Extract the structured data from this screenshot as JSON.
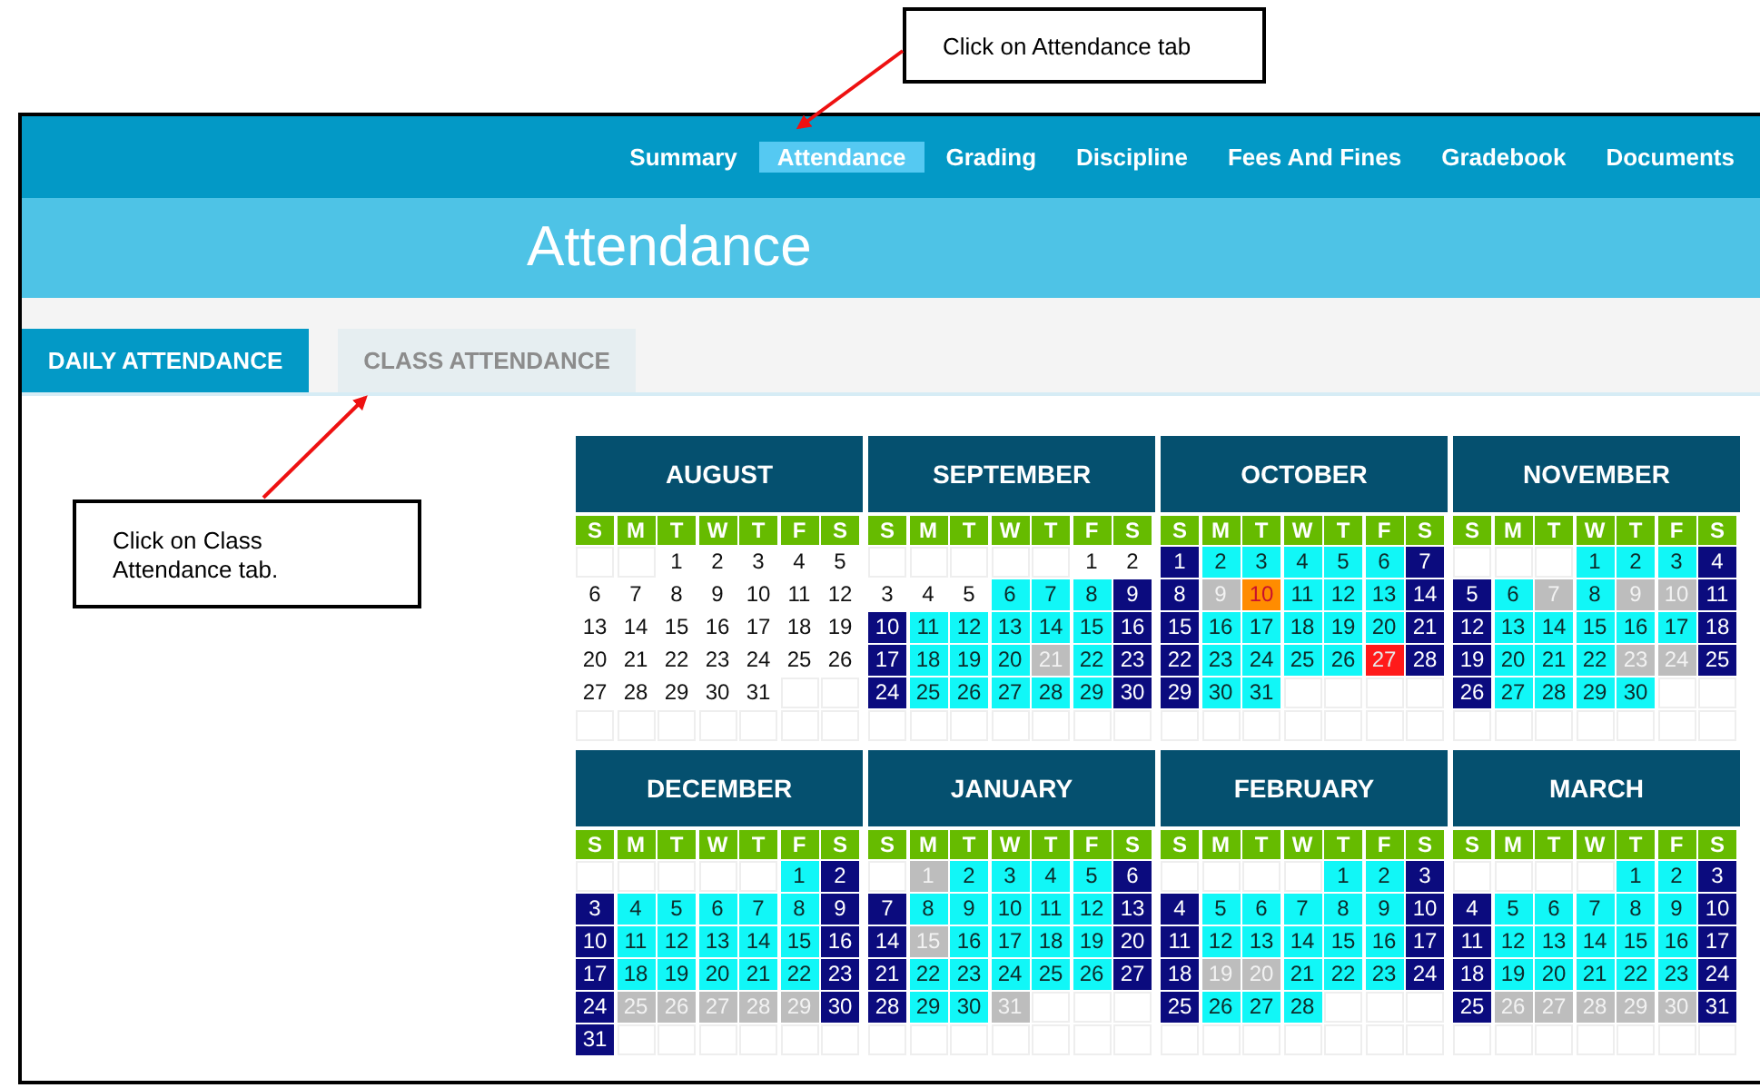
{
  "callouts": [
    {
      "text": "Click on Attendance tab"
    },
    {
      "text": "Click on Class Attendance tab."
    }
  ],
  "nav": {
    "tabs": [
      {
        "label": "Summary",
        "selected": false
      },
      {
        "label": "Attendance",
        "selected": true
      },
      {
        "label": "Grading",
        "selected": false
      },
      {
        "label": "Discipline",
        "selected": false
      },
      {
        "label": "Fees And Fines",
        "selected": false
      },
      {
        "label": "Gradebook",
        "selected": false
      },
      {
        "label": "Documents",
        "selected": false
      }
    ]
  },
  "page_title": "Attendance",
  "sub_tabs": [
    {
      "label": "DAILY ATTENDANCE",
      "selected": true
    },
    {
      "label": "CLASS ATTENDANCE",
      "selected": false
    }
  ],
  "months": [
    {
      "name": "AUGUST",
      "weekdays": [
        "S",
        "M",
        "T",
        "W",
        "T",
        "F",
        "S"
      ],
      "weeks": [
        [
          {
            "kind": "blank"
          },
          {
            "kind": "blank"
          },
          {
            "day": "1",
            "kind": "plain"
          },
          {
            "day": "2",
            "kind": "plain"
          },
          {
            "day": "3",
            "kind": "plain"
          },
          {
            "day": "4",
            "kind": "plain"
          },
          {
            "day": "5",
            "kind": "plain"
          }
        ],
        [
          {
            "day": "6",
            "kind": "plain"
          },
          {
            "day": "7",
            "kind": "plain"
          },
          {
            "day": "8",
            "kind": "plain"
          },
          {
            "day": "9",
            "kind": "plain"
          },
          {
            "day": "10",
            "kind": "plain"
          },
          {
            "day": "11",
            "kind": "plain"
          },
          {
            "day": "12",
            "kind": "plain"
          }
        ],
        [
          {
            "day": "13",
            "kind": "plain"
          },
          {
            "day": "14",
            "kind": "plain"
          },
          {
            "day": "15",
            "kind": "plain"
          },
          {
            "day": "16",
            "kind": "plain"
          },
          {
            "day": "17",
            "kind": "plain"
          },
          {
            "day": "18",
            "kind": "plain"
          },
          {
            "day": "19",
            "kind": "plain"
          }
        ],
        [
          {
            "day": "20",
            "kind": "plain"
          },
          {
            "day": "21",
            "kind": "plain"
          },
          {
            "day": "22",
            "kind": "plain"
          },
          {
            "day": "23",
            "kind": "plain"
          },
          {
            "day": "24",
            "kind": "plain"
          },
          {
            "day": "25",
            "kind": "plain"
          },
          {
            "day": "26",
            "kind": "plain"
          }
        ],
        [
          {
            "day": "27",
            "kind": "plain"
          },
          {
            "day": "28",
            "kind": "plain"
          },
          {
            "day": "29",
            "kind": "plain"
          },
          {
            "day": "30",
            "kind": "plain"
          },
          {
            "day": "31",
            "kind": "plain"
          },
          {
            "kind": "blank"
          },
          {
            "kind": "blank"
          }
        ],
        [
          {
            "kind": "blank"
          },
          {
            "kind": "blank"
          },
          {
            "kind": "blank"
          },
          {
            "kind": "blank"
          },
          {
            "kind": "blank"
          },
          {
            "kind": "blank"
          },
          {
            "kind": "blank"
          }
        ]
      ]
    },
    {
      "name": "SEPTEMBER",
      "weekdays": [
        "S",
        "M",
        "T",
        "W",
        "T",
        "F",
        "S"
      ],
      "weeks": [
        [
          {
            "kind": "blank"
          },
          {
            "kind": "blank"
          },
          {
            "kind": "blank"
          },
          {
            "kind": "blank"
          },
          {
            "kind": "blank"
          },
          {
            "day": "1",
            "kind": "plain"
          },
          {
            "day": "2",
            "kind": "plain"
          }
        ],
        [
          {
            "day": "3",
            "kind": "plain"
          },
          {
            "day": "4",
            "kind": "plain"
          },
          {
            "day": "5",
            "kind": "plain"
          },
          {
            "day": "6",
            "kind": "school"
          },
          {
            "day": "7",
            "kind": "school"
          },
          {
            "day": "8",
            "kind": "school"
          },
          {
            "day": "9",
            "kind": "weekend"
          }
        ],
        [
          {
            "day": "10",
            "kind": "weekend"
          },
          {
            "day": "11",
            "kind": "school"
          },
          {
            "day": "12",
            "kind": "school"
          },
          {
            "day": "13",
            "kind": "school"
          },
          {
            "day": "14",
            "kind": "school"
          },
          {
            "day": "15",
            "kind": "school"
          },
          {
            "day": "16",
            "kind": "weekend"
          }
        ],
        [
          {
            "day": "17",
            "kind": "weekend"
          },
          {
            "day": "18",
            "kind": "school"
          },
          {
            "day": "19",
            "kind": "school"
          },
          {
            "day": "20",
            "kind": "school"
          },
          {
            "day": "21",
            "kind": "holiday"
          },
          {
            "day": "22",
            "kind": "school"
          },
          {
            "day": "23",
            "kind": "weekend"
          }
        ],
        [
          {
            "day": "24",
            "kind": "weekend"
          },
          {
            "day": "25",
            "kind": "school"
          },
          {
            "day": "26",
            "kind": "school"
          },
          {
            "day": "27",
            "kind": "school"
          },
          {
            "day": "28",
            "kind": "school"
          },
          {
            "day": "29",
            "kind": "school"
          },
          {
            "day": "30",
            "kind": "weekend"
          }
        ],
        [
          {
            "kind": "blank"
          },
          {
            "kind": "blank"
          },
          {
            "kind": "blank"
          },
          {
            "kind": "blank"
          },
          {
            "kind": "blank"
          },
          {
            "kind": "blank"
          },
          {
            "kind": "blank"
          }
        ]
      ]
    },
    {
      "name": "OCTOBER",
      "weekdays": [
        "S",
        "M",
        "T",
        "W",
        "T",
        "F",
        "S"
      ],
      "weeks": [
        [
          {
            "day": "1",
            "kind": "weekend"
          },
          {
            "day": "2",
            "kind": "school"
          },
          {
            "day": "3",
            "kind": "school"
          },
          {
            "day": "4",
            "kind": "school"
          },
          {
            "day": "5",
            "kind": "school"
          },
          {
            "day": "6",
            "kind": "school"
          },
          {
            "day": "7",
            "kind": "weekend"
          }
        ],
        [
          {
            "day": "8",
            "kind": "weekend"
          },
          {
            "day": "9",
            "kind": "holiday"
          },
          {
            "day": "10",
            "kind": "late"
          },
          {
            "day": "11",
            "kind": "school"
          },
          {
            "day": "12",
            "kind": "school"
          },
          {
            "day": "13",
            "kind": "school"
          },
          {
            "day": "14",
            "kind": "weekend"
          }
        ],
        [
          {
            "day": "15",
            "kind": "weekend"
          },
          {
            "day": "16",
            "kind": "school"
          },
          {
            "day": "17",
            "kind": "school"
          },
          {
            "day": "18",
            "kind": "school"
          },
          {
            "day": "19",
            "kind": "school"
          },
          {
            "day": "20",
            "kind": "school"
          },
          {
            "day": "21",
            "kind": "weekend"
          }
        ],
        [
          {
            "day": "22",
            "kind": "weekend"
          },
          {
            "day": "23",
            "kind": "school"
          },
          {
            "day": "24",
            "kind": "school"
          },
          {
            "day": "25",
            "kind": "school"
          },
          {
            "day": "26",
            "kind": "school"
          },
          {
            "day": "27",
            "kind": "absent"
          },
          {
            "day": "28",
            "kind": "weekend"
          }
        ],
        [
          {
            "day": "29",
            "kind": "weekend"
          },
          {
            "day": "30",
            "kind": "school"
          },
          {
            "day": "31",
            "kind": "school"
          },
          {
            "kind": "blank"
          },
          {
            "kind": "blank"
          },
          {
            "kind": "blank"
          },
          {
            "kind": "blank"
          }
        ],
        [
          {
            "kind": "blank"
          },
          {
            "kind": "blank"
          },
          {
            "kind": "blank"
          },
          {
            "kind": "blank"
          },
          {
            "kind": "blank"
          },
          {
            "kind": "blank"
          },
          {
            "kind": "blank"
          }
        ]
      ]
    },
    {
      "name": "NOVEMBER",
      "weekdays": [
        "S",
        "M",
        "T",
        "W",
        "T",
        "F",
        "S"
      ],
      "weeks": [
        [
          {
            "kind": "blank"
          },
          {
            "kind": "blank"
          },
          {
            "kind": "blank"
          },
          {
            "day": "1",
            "kind": "school"
          },
          {
            "day": "2",
            "kind": "school"
          },
          {
            "day": "3",
            "kind": "school"
          },
          {
            "day": "4",
            "kind": "weekend"
          }
        ],
        [
          {
            "day": "5",
            "kind": "weekend"
          },
          {
            "day": "6",
            "kind": "school"
          },
          {
            "day": "7",
            "kind": "holiday"
          },
          {
            "day": "8",
            "kind": "school"
          },
          {
            "day": "9",
            "kind": "holiday"
          },
          {
            "day": "10",
            "kind": "holiday"
          },
          {
            "day": "11",
            "kind": "weekend"
          }
        ],
        [
          {
            "day": "12",
            "kind": "weekend"
          },
          {
            "day": "13",
            "kind": "school"
          },
          {
            "day": "14",
            "kind": "school"
          },
          {
            "day": "15",
            "kind": "school"
          },
          {
            "day": "16",
            "kind": "school"
          },
          {
            "day": "17",
            "kind": "school"
          },
          {
            "day": "18",
            "kind": "weekend"
          }
        ],
        [
          {
            "day": "19",
            "kind": "weekend"
          },
          {
            "day": "20",
            "kind": "school"
          },
          {
            "day": "21",
            "kind": "school"
          },
          {
            "day": "22",
            "kind": "school"
          },
          {
            "day": "23",
            "kind": "holiday"
          },
          {
            "day": "24",
            "kind": "holiday"
          },
          {
            "day": "25",
            "kind": "weekend"
          }
        ],
        [
          {
            "day": "26",
            "kind": "weekend"
          },
          {
            "day": "27",
            "kind": "school"
          },
          {
            "day": "28",
            "kind": "school"
          },
          {
            "day": "29",
            "kind": "school"
          },
          {
            "day": "30",
            "kind": "school"
          },
          {
            "kind": "blank"
          },
          {
            "kind": "blank"
          }
        ],
        [
          {
            "kind": "blank"
          },
          {
            "kind": "blank"
          },
          {
            "kind": "blank"
          },
          {
            "kind": "blank"
          },
          {
            "kind": "blank"
          },
          {
            "kind": "blank"
          },
          {
            "kind": "blank"
          }
        ]
      ]
    },
    {
      "name": "DECEMBER",
      "weekdays": [
        "S",
        "M",
        "T",
        "W",
        "T",
        "F",
        "S"
      ],
      "weeks": [
        [
          {
            "kind": "blank"
          },
          {
            "kind": "blank"
          },
          {
            "kind": "blank"
          },
          {
            "kind": "blank"
          },
          {
            "kind": "blank"
          },
          {
            "day": "1",
            "kind": "school"
          },
          {
            "day": "2",
            "kind": "weekend"
          }
        ],
        [
          {
            "day": "3",
            "kind": "weekend"
          },
          {
            "day": "4",
            "kind": "school"
          },
          {
            "day": "5",
            "kind": "school"
          },
          {
            "day": "6",
            "kind": "school"
          },
          {
            "day": "7",
            "kind": "school"
          },
          {
            "day": "8",
            "kind": "school"
          },
          {
            "day": "9",
            "kind": "weekend"
          }
        ],
        [
          {
            "day": "10",
            "kind": "weekend"
          },
          {
            "day": "11",
            "kind": "school"
          },
          {
            "day": "12",
            "kind": "school"
          },
          {
            "day": "13",
            "kind": "school"
          },
          {
            "day": "14",
            "kind": "school"
          },
          {
            "day": "15",
            "kind": "school"
          },
          {
            "day": "16",
            "kind": "weekend"
          }
        ],
        [
          {
            "day": "17",
            "kind": "weekend"
          },
          {
            "day": "18",
            "kind": "school"
          },
          {
            "day": "19",
            "kind": "school"
          },
          {
            "day": "20",
            "kind": "school"
          },
          {
            "day": "21",
            "kind": "school"
          },
          {
            "day": "22",
            "kind": "school"
          },
          {
            "day": "23",
            "kind": "weekend"
          }
        ],
        [
          {
            "day": "24",
            "kind": "weekend"
          },
          {
            "day": "25",
            "kind": "holiday"
          },
          {
            "day": "26",
            "kind": "holiday"
          },
          {
            "day": "27",
            "kind": "holiday"
          },
          {
            "day": "28",
            "kind": "holiday"
          },
          {
            "day": "29",
            "kind": "holiday"
          },
          {
            "day": "30",
            "kind": "weekend"
          }
        ],
        [
          {
            "day": "31",
            "kind": "weekend"
          },
          {
            "kind": "blank"
          },
          {
            "kind": "blank"
          },
          {
            "kind": "blank"
          },
          {
            "kind": "blank"
          },
          {
            "kind": "blank"
          },
          {
            "kind": "blank"
          }
        ]
      ]
    },
    {
      "name": "JANUARY",
      "weekdays": [
        "S",
        "M",
        "T",
        "W",
        "T",
        "F",
        "S"
      ],
      "weeks": [
        [
          {
            "kind": "blank"
          },
          {
            "day": "1",
            "kind": "holiday"
          },
          {
            "day": "2",
            "kind": "school"
          },
          {
            "day": "3",
            "kind": "school"
          },
          {
            "day": "4",
            "kind": "school"
          },
          {
            "day": "5",
            "kind": "school"
          },
          {
            "day": "6",
            "kind": "weekend"
          }
        ],
        [
          {
            "day": "7",
            "kind": "weekend"
          },
          {
            "day": "8",
            "kind": "school"
          },
          {
            "day": "9",
            "kind": "school"
          },
          {
            "day": "10",
            "kind": "school"
          },
          {
            "day": "11",
            "kind": "school"
          },
          {
            "day": "12",
            "kind": "school"
          },
          {
            "day": "13",
            "kind": "weekend"
          }
        ],
        [
          {
            "day": "14",
            "kind": "weekend"
          },
          {
            "day": "15",
            "kind": "holiday"
          },
          {
            "day": "16",
            "kind": "school"
          },
          {
            "day": "17",
            "kind": "school"
          },
          {
            "day": "18",
            "kind": "school"
          },
          {
            "day": "19",
            "kind": "school"
          },
          {
            "day": "20",
            "kind": "weekend"
          }
        ],
        [
          {
            "day": "21",
            "kind": "weekend"
          },
          {
            "day": "22",
            "kind": "school"
          },
          {
            "day": "23",
            "kind": "school"
          },
          {
            "day": "24",
            "kind": "school"
          },
          {
            "day": "25",
            "kind": "school"
          },
          {
            "day": "26",
            "kind": "school"
          },
          {
            "day": "27",
            "kind": "weekend"
          }
        ],
        [
          {
            "day": "28",
            "kind": "weekend"
          },
          {
            "day": "29",
            "kind": "school"
          },
          {
            "day": "30",
            "kind": "school"
          },
          {
            "day": "31",
            "kind": "holiday"
          },
          {
            "kind": "blank"
          },
          {
            "kind": "blank"
          },
          {
            "kind": "blank"
          }
        ],
        [
          {
            "kind": "blank"
          },
          {
            "kind": "blank"
          },
          {
            "kind": "blank"
          },
          {
            "kind": "blank"
          },
          {
            "kind": "blank"
          },
          {
            "kind": "blank"
          },
          {
            "kind": "blank"
          }
        ]
      ]
    },
    {
      "name": "FEBRUARY",
      "weekdays": [
        "S",
        "M",
        "T",
        "W",
        "T",
        "F",
        "S"
      ],
      "weeks": [
        [
          {
            "kind": "blank"
          },
          {
            "kind": "blank"
          },
          {
            "kind": "blank"
          },
          {
            "kind": "blank"
          },
          {
            "day": "1",
            "kind": "school"
          },
          {
            "day": "2",
            "kind": "school"
          },
          {
            "day": "3",
            "kind": "weekend"
          }
        ],
        [
          {
            "day": "4",
            "kind": "weekend"
          },
          {
            "day": "5",
            "kind": "school"
          },
          {
            "day": "6",
            "kind": "school"
          },
          {
            "day": "7",
            "kind": "school"
          },
          {
            "day": "8",
            "kind": "school"
          },
          {
            "day": "9",
            "kind": "school"
          },
          {
            "day": "10",
            "kind": "weekend"
          }
        ],
        [
          {
            "day": "11",
            "kind": "weekend"
          },
          {
            "day": "12",
            "kind": "school"
          },
          {
            "day": "13",
            "kind": "school"
          },
          {
            "day": "14",
            "kind": "school"
          },
          {
            "day": "15",
            "kind": "school"
          },
          {
            "day": "16",
            "kind": "school"
          },
          {
            "day": "17",
            "kind": "weekend"
          }
        ],
        [
          {
            "day": "18",
            "kind": "weekend"
          },
          {
            "day": "19",
            "kind": "holiday"
          },
          {
            "day": "20",
            "kind": "holiday"
          },
          {
            "day": "21",
            "kind": "school"
          },
          {
            "day": "22",
            "kind": "school"
          },
          {
            "day": "23",
            "kind": "school"
          },
          {
            "day": "24",
            "kind": "weekend"
          }
        ],
        [
          {
            "day": "25",
            "kind": "weekend"
          },
          {
            "day": "26",
            "kind": "school"
          },
          {
            "day": "27",
            "kind": "school"
          },
          {
            "day": "28",
            "kind": "school"
          },
          {
            "kind": "blank"
          },
          {
            "kind": "blank"
          },
          {
            "kind": "blank"
          }
        ],
        [
          {
            "kind": "blank"
          },
          {
            "kind": "blank"
          },
          {
            "kind": "blank"
          },
          {
            "kind": "blank"
          },
          {
            "kind": "blank"
          },
          {
            "kind": "blank"
          },
          {
            "kind": "blank"
          }
        ]
      ]
    },
    {
      "name": "MARCH",
      "weekdays": [
        "S",
        "M",
        "T",
        "W",
        "T",
        "F",
        "S"
      ],
      "weeks": [
        [
          {
            "kind": "blank"
          },
          {
            "kind": "blank"
          },
          {
            "kind": "blank"
          },
          {
            "kind": "blank"
          },
          {
            "day": "1",
            "kind": "school"
          },
          {
            "day": "2",
            "kind": "school"
          },
          {
            "day": "3",
            "kind": "weekend"
          }
        ],
        [
          {
            "day": "4",
            "kind": "weekend"
          },
          {
            "day": "5",
            "kind": "school"
          },
          {
            "day": "6",
            "kind": "school"
          },
          {
            "day": "7",
            "kind": "school"
          },
          {
            "day": "8",
            "kind": "school"
          },
          {
            "day": "9",
            "kind": "school"
          },
          {
            "day": "10",
            "kind": "weekend"
          }
        ],
        [
          {
            "day": "11",
            "kind": "weekend"
          },
          {
            "day": "12",
            "kind": "school"
          },
          {
            "day": "13",
            "kind": "school"
          },
          {
            "day": "14",
            "kind": "school"
          },
          {
            "day": "15",
            "kind": "school"
          },
          {
            "day": "16",
            "kind": "school"
          },
          {
            "day": "17",
            "kind": "weekend"
          }
        ],
        [
          {
            "day": "18",
            "kind": "weekend"
          },
          {
            "day": "19",
            "kind": "school"
          },
          {
            "day": "20",
            "kind": "school"
          },
          {
            "day": "21",
            "kind": "school"
          },
          {
            "day": "22",
            "kind": "school"
          },
          {
            "day": "23",
            "kind": "school"
          },
          {
            "day": "24",
            "kind": "weekend"
          }
        ],
        [
          {
            "day": "25",
            "kind": "weekend"
          },
          {
            "day": "26",
            "kind": "holiday"
          },
          {
            "day": "27",
            "kind": "holiday"
          },
          {
            "day": "28",
            "kind": "holiday"
          },
          {
            "day": "29",
            "kind": "holiday"
          },
          {
            "day": "30",
            "kind": "holiday"
          },
          {
            "day": "31",
            "kind": "weekend"
          }
        ],
        [
          {
            "kind": "blank"
          },
          {
            "kind": "blank"
          },
          {
            "kind": "blank"
          },
          {
            "kind": "blank"
          },
          {
            "kind": "blank"
          },
          {
            "kind": "blank"
          },
          {
            "kind": "blank"
          }
        ]
      ]
    }
  ]
}
